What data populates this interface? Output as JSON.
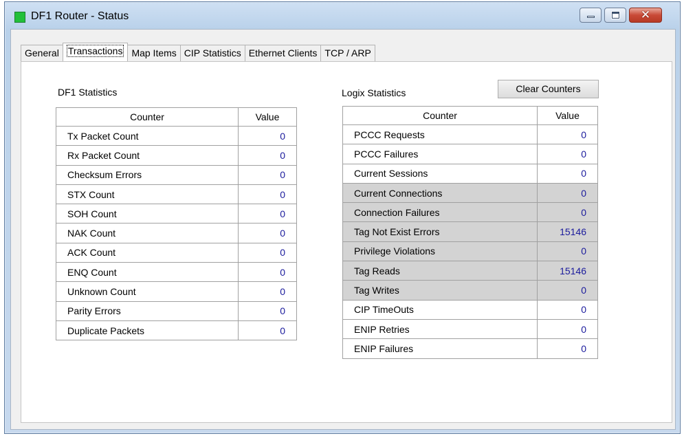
{
  "window": {
    "title": "DF1 Router - Status",
    "app_icon": "green-square-icon",
    "close_glyph": "✕"
  },
  "tabs": [
    {
      "label": "General",
      "active": false
    },
    {
      "label": "Transactions",
      "active": true
    },
    {
      "label": "Map Items",
      "active": false
    },
    {
      "label": "CIP Statistics",
      "active": false
    },
    {
      "label": "Ethernet Clients",
      "active": false
    },
    {
      "label": "TCP / ARP",
      "active": false
    }
  ],
  "df1": {
    "title": "DF1 Statistics",
    "headers": {
      "counter": "Counter",
      "value": "Value"
    },
    "rows": [
      {
        "counter": "Tx Packet Count",
        "value": "0"
      },
      {
        "counter": "Rx Packet Count",
        "value": "0"
      },
      {
        "counter": "Checksum Errors",
        "value": "0"
      },
      {
        "counter": "STX Count",
        "value": "0"
      },
      {
        "counter": "SOH Count",
        "value": "0"
      },
      {
        "counter": "NAK Count",
        "value": "0"
      },
      {
        "counter": "ACK Count",
        "value": "0"
      },
      {
        "counter": "ENQ Count",
        "value": "0"
      },
      {
        "counter": "Unknown Count",
        "value": "0"
      },
      {
        "counter": "Parity Errors",
        "value": "0"
      },
      {
        "counter": "Duplicate Packets",
        "value": "0"
      }
    ]
  },
  "logix": {
    "title": "Logix Statistics",
    "clear_button": "Clear Counters",
    "headers": {
      "counter": "Counter",
      "value": "Value"
    },
    "rows": [
      {
        "counter": "PCCC Requests",
        "value": "0",
        "highlighted": false
      },
      {
        "counter": "PCCC Failures",
        "value": "0",
        "highlighted": false
      },
      {
        "counter": "Current Sessions",
        "value": "0",
        "highlighted": false
      },
      {
        "counter": "Current Connections",
        "value": "0",
        "highlighted": true
      },
      {
        "counter": "Connection Failures",
        "value": "0",
        "highlighted": true
      },
      {
        "counter": "Tag Not Exist Errors",
        "value": "15146",
        "highlighted": true
      },
      {
        "counter": "Privilege Violations",
        "value": "0",
        "highlighted": true
      },
      {
        "counter": "Tag Reads",
        "value": "15146",
        "highlighted": true
      },
      {
        "counter": "Tag Writes",
        "value": "0",
        "highlighted": true
      },
      {
        "counter": "CIP TimeOuts",
        "value": "0",
        "highlighted": false
      },
      {
        "counter": "ENIP Retries",
        "value": "0",
        "highlighted": false
      },
      {
        "counter": "ENIP Failures",
        "value": "0",
        "highlighted": false
      }
    ]
  },
  "colors": {
    "value_text": "#1a1a9c",
    "highlight_row": "#d3d3d3",
    "app_icon": "#22c03a"
  }
}
